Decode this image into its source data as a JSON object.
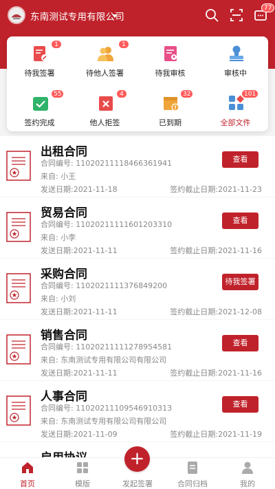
{
  "header": {
    "company": "东南测试专用有限公司",
    "message_count": "77",
    "icons": [
      "search-icon",
      "scan-icon",
      "message-icon"
    ]
  },
  "colors": {
    "brand": "#c0222b",
    "badge": "#ff5b5b"
  },
  "categories": [
    {
      "label": "待我签署",
      "count": "1",
      "icon": "sign-doc-icon"
    },
    {
      "label": "待他人签署",
      "count": "1",
      "icon": "users-icon"
    },
    {
      "label": "待我审核",
      "count": "",
      "icon": "review-doc-icon"
    },
    {
      "label": "审核中",
      "count": "",
      "icon": "stamp-icon"
    },
    {
      "label": "签约完成",
      "count": "55",
      "icon": "check-folder-icon"
    },
    {
      "label": "他人拒签",
      "count": "4",
      "icon": "reject-icon"
    },
    {
      "label": "已到期",
      "count": "32",
      "icon": "expired-icon"
    },
    {
      "label": "全部文件",
      "count": "101",
      "icon": "all-files-icon"
    }
  ],
  "contracts": [
    {
      "title": "出租合同",
      "number": "合同编号: 11020211118466361941",
      "from": "来自: 小王",
      "sent": "发送日期:2021-11-18",
      "deadline": "签约截止日期:2021-11-23",
      "action": "查看"
    },
    {
      "title": "贸易合同",
      "number": "合同编号: 11020211111601203310",
      "from": "来自: 小李",
      "sent": "发送日期:2021-11-11",
      "deadline": "签约截止日期:2021-11-16",
      "action": "查看"
    },
    {
      "title": "采购合同",
      "number": "合同编号: 1102021111376849200",
      "from": "来自: 小刘",
      "sent": "发送日期:2021-11-11",
      "deadline": "签约截止日期:2021-12-08",
      "action": "待我签署"
    },
    {
      "title": "销售合同",
      "number": "合同编号: 11020211111278954581",
      "from": "来自: 东南测试专用有限公司有限公司",
      "sent": "发送日期:2021-11-11",
      "deadline": "签约截止日期:2021-11-16",
      "action": "查看"
    },
    {
      "title": "人事合同",
      "number": "合同编号: 11020211109546910313",
      "from": "来自: 东南测试专用有限公司有限公司",
      "sent": "发送日期:2021-11-09",
      "deadline": "签约截止日期:2021-11-19",
      "action": "查看"
    },
    {
      "title": "启用协议",
      "number": "",
      "from": "",
      "sent": "",
      "deadline": "",
      "action": ""
    }
  ],
  "tabs": [
    {
      "label": "首页",
      "icon": "home-icon",
      "active": true
    },
    {
      "label": "模版",
      "icon": "template-icon",
      "active": false
    },
    {
      "label": "发起签署",
      "icon": "plus-icon",
      "active": false
    },
    {
      "label": "合同归档",
      "icon": "archive-icon",
      "active": false
    },
    {
      "label": "我的",
      "icon": "profile-icon",
      "active": false
    }
  ]
}
